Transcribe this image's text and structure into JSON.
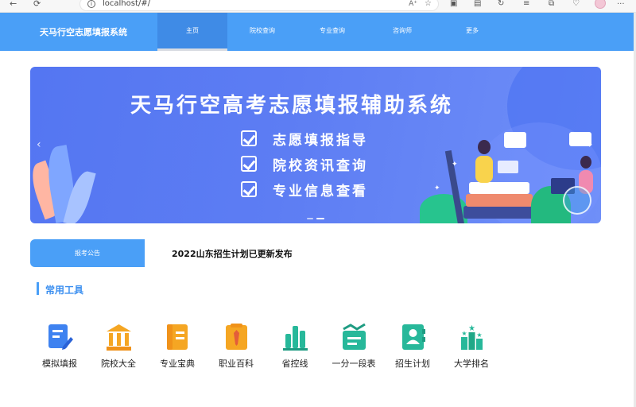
{
  "browser": {
    "address": "localhost/#/",
    "back_icon": "←",
    "refresh_icon": "⟳",
    "info_icon": "i",
    "reader_icon": "A⁺",
    "favorite_icon": "☆",
    "more_icon": "···"
  },
  "header": {
    "title": "天马行空志愿填报系统",
    "nav": [
      {
        "label": "主页",
        "active": true
      },
      {
        "label": "院校查询",
        "active": false
      },
      {
        "label": "专业查询",
        "active": false
      },
      {
        "label": "咨询师",
        "active": false
      },
      {
        "label": "更多",
        "active": false
      }
    ]
  },
  "banner": {
    "title": "天马行空高考志愿填报辅助系统",
    "features": [
      "志愿填报指导",
      "院校资讯查询",
      "专业信息查看"
    ],
    "prev_icon": "‹",
    "next_icon": "›"
  },
  "notice": {
    "tab_label": "报考公告",
    "text": "2022山东招生计划已更新发布"
  },
  "tools": {
    "section_title": "常用工具",
    "items": [
      {
        "label": "模拟填报",
        "icon": "edit-document-icon",
        "color": "#3e82f0"
      },
      {
        "label": "院校大全",
        "icon": "university-icon",
        "color": "#f5a623"
      },
      {
        "label": "专业宝典",
        "icon": "book-icon",
        "color": "#f5a623"
      },
      {
        "label": "职业百科",
        "icon": "career-tie-icon",
        "color": "#f5a623"
      },
      {
        "label": "省控线",
        "icon": "bar-chart-icon",
        "color": "#27b89a"
      },
      {
        "label": "一分一段表",
        "icon": "score-table-icon",
        "color": "#27b89a"
      },
      {
        "label": "招生计划",
        "icon": "enrollment-plan-icon",
        "color": "#27b89a"
      },
      {
        "label": "大学排名",
        "icon": "ranking-icon",
        "color": "#27b89a"
      }
    ]
  }
}
